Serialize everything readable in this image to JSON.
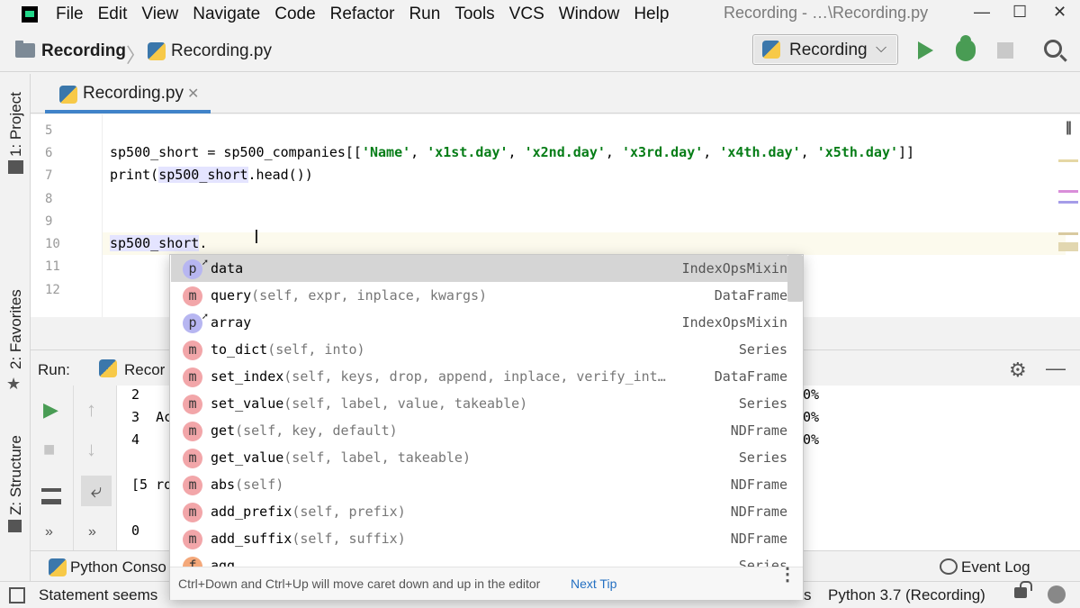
{
  "menubar": {
    "items": [
      "File",
      "Edit",
      "View",
      "Navigate",
      "Code",
      "Refactor",
      "Run",
      "Tools",
      "VCS",
      "Window",
      "Help"
    ],
    "window_title": "Recording - …\\Recording.py",
    "minimize": "—",
    "maximize": "☐",
    "close": "✕"
  },
  "navbar": {
    "project": "Recording",
    "separator": "〉",
    "file": "Recording.py",
    "run_config": "Recording",
    "run_config_chevron": "⌵"
  },
  "left_strip": {
    "tabs": [
      "1: Project",
      "2: Favorites",
      "Z: Structure"
    ]
  },
  "editor": {
    "tab_label": "Recording.py",
    "tab_close": "✕",
    "pause": "||",
    "lines": [
      {
        "num": "5"
      },
      {
        "num": "6",
        "code_var": "sp500_short",
        "code_rest": " = sp500_companies[[",
        "strings": [
          "'Name'",
          "'x1st.day'",
          "'x2nd.day'",
          "'x3rd.day'",
          "'x4th.day'",
          "'x5th.day'"
        ],
        "code_end": "]]"
      },
      {
        "num": "7",
        "code_pre": "print(",
        "code_var": "sp500_short",
        "code_post": ".head())"
      },
      {
        "num": "8"
      },
      {
        "num": "9"
      },
      {
        "num": "10",
        "code_var": "sp500_short",
        "code_post": "."
      },
      {
        "num": "11"
      },
      {
        "num": "12"
      }
    ],
    "caret_glyph": "I",
    "markers": [
      "#e5d7a5",
      "#d98ed9",
      "#a59ce8",
      "#d9caa0"
    ]
  },
  "run_panel": {
    "label": "Run:",
    "tab_label": "Recor",
    "gear": "⚙",
    "minimize": "—",
    "output_left": [
      "2",
      "3  Ac",
      "4",
      "",
      "[5 ro",
      "",
      "0"
    ],
    "output_right": [
      "0%",
      "0%",
      "0%"
    ],
    "side_buttons": [
      "▶",
      "↑",
      "■",
      "↓",
      "⤶",
      "»",
      "»"
    ]
  },
  "completion": {
    "items": [
      {
        "kind": "p",
        "name": "data",
        "sig": "",
        "type": "IndexOpsMixin",
        "selected": true
      },
      {
        "kind": "m",
        "name": "query",
        "sig": "(self, expr, inplace, kwargs)",
        "type": "DataFrame"
      },
      {
        "kind": "p",
        "name": "array",
        "sig": "",
        "type": "IndexOpsMixin"
      },
      {
        "kind": "m",
        "name": "to_dict",
        "sig": "(self, into)",
        "type": "Series"
      },
      {
        "kind": "m",
        "name": "set_index",
        "sig": "(self, keys, drop, append, inplace, verify_int…",
        "type": "DataFrame"
      },
      {
        "kind": "m",
        "name": "set_value",
        "sig": "(self, label, value, takeable)",
        "type": "Series"
      },
      {
        "kind": "m",
        "name": "get",
        "sig": "(self, key, default)",
        "type": "NDFrame"
      },
      {
        "kind": "m",
        "name": "get_value",
        "sig": "(self, label, takeable)",
        "type": "Series"
      },
      {
        "kind": "m",
        "name": "abs",
        "sig": "(self)",
        "type": "NDFrame"
      },
      {
        "kind": "m",
        "name": "add_prefix",
        "sig": "(self, prefix)",
        "type": "NDFrame"
      },
      {
        "kind": "m",
        "name": "add_suffix",
        "sig": "(self, suffix)",
        "type": "NDFrame"
      },
      {
        "kind": "f",
        "name": "agg",
        "sig": "",
        "type": "Series"
      }
    ],
    "tip": "Ctrl+Down and Ctrl+Up will move caret down and up in the editor",
    "next_tip": "Next Tip",
    "more": "⋮"
  },
  "bottom_tabs": {
    "python_console": "Python Conso",
    "event_log": "Event Log"
  },
  "statusbar": {
    "text": "Statement seems",
    "spaces_fragment": "s",
    "interpreter": "Python 3.7 (Recording)"
  }
}
